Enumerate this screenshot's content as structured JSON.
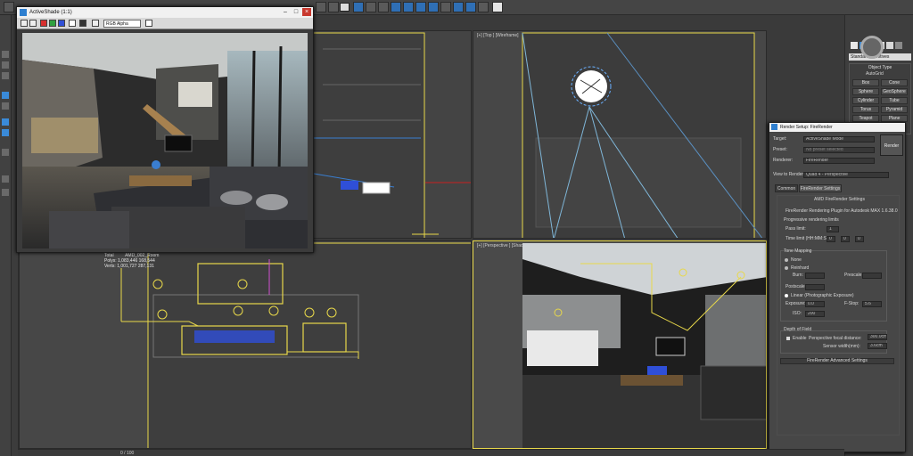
{
  "toolbar": {
    "selection_set_value": "",
    "view_dropdown_value": ""
  },
  "viewports": {
    "top": {
      "label": "[+] [Top ] [Wireframe]"
    },
    "front": {
      "label": ""
    },
    "left": {
      "label": ""
    },
    "perspective": {
      "label": "[+] [Perspective ] [Shaded ]"
    },
    "stats": {
      "total_label": "Total",
      "object_name": "AMD_002_Room",
      "polys_label": "Polys:",
      "polys_value": "1,083,446",
      "polys_value2": "168,544",
      "verts_label": "Verts:",
      "verts_value": "1,001,727",
      "verts_value2": "287,131"
    }
  },
  "activeshade": {
    "title": "ActiveShade (1:1)",
    "channel": "RGB Alpha",
    "controls": {
      "minimize": "–",
      "maximize": "□",
      "close": "×"
    }
  },
  "command_panel": {
    "primitive_type": "Standard Primitives",
    "section_title": "Object Type",
    "autogrid_label": "AutoGrid",
    "buttons": [
      "Box",
      "Cone",
      "Sphere",
      "GeoSphere",
      "Cylinder",
      "Tube",
      "Torus",
      "Pyramid",
      "Teapot",
      "Plane"
    ]
  },
  "render_setup": {
    "title": "Render Setup: FireRender",
    "target_label": "Target:",
    "target_value": "ActiveShade Mode",
    "preset_label": "Preset:",
    "preset_value": "No preset selected",
    "renderer_label": "Renderer:",
    "renderer_value": "FireRender",
    "view_label": "View to Render:",
    "view_value": "Quad 4 - Perspective",
    "render_button": "Render",
    "tabs": [
      "Common",
      "FireRender Settings"
    ],
    "rollout_title": "AMD FireRender Settings",
    "plugin_text": "FireRender Rendering Plugin for Autodesk MAX 1.6.38.0",
    "progressive_label": "Progressive rendering limits",
    "pass_limit_label": "Pass limit:",
    "pass_limit_value": "1",
    "time_limit_label": "Time limit (HH:MM:SS):",
    "time_limit_values": [
      "0",
      "0",
      "0"
    ],
    "tone_mapping_label": "Tone Mapping",
    "tm_none": "None",
    "tm_reinhard": "Reinhard",
    "burn_label": "Burn:",
    "burn_value": "",
    "prescale_label": "Prescale:",
    "prescale_value": "",
    "postscale_label": "Postscale:",
    "postscale_value": "",
    "tm_linear": "Linear (Photographic Exposure)",
    "exposure_label": "Exposure:",
    "exposure_value": "0.0",
    "fstop_label": "F-Stop:",
    "fstop_value": "5.6",
    "iso_label": "ISO:",
    "iso_value": "200",
    "dof_label": "Depth of Field",
    "enable_label": "Enable",
    "focal_label": "Perspective focal distance:",
    "focal_value": "300.0cm",
    "sensor_label": "Sensor width(mm):",
    "sensor_value": "3.6cm",
    "advanced_rollout": "FireRender Advanced Settings"
  },
  "timeline": {
    "frame": "0 / 100"
  }
}
